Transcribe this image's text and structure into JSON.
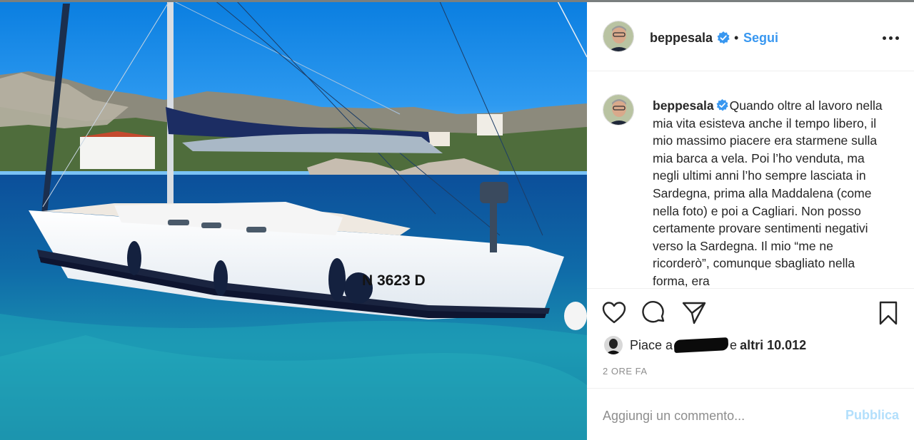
{
  "post": {
    "username": "beppesala",
    "verified": true,
    "separator": "•",
    "follow_label": "Segui",
    "more_icon": "more-horizontal-icon",
    "caption_text": "Quando oltre al lavoro nella mia vita esisteva anche il tempo libero, il mio massimo piacere era starmene sulla mia barca a vela. Poi l’ho venduta, ma negli ultimi anni l’ho sempre lasciata in Sardegna, prima alla Maddalena (come nella foto) e poi a Cagliari. Non posso certamente provare sentimenti negativi verso la Sardegna. Il mio “me ne ricorderò”, comunque sbagliato nella forma, era",
    "photo": {
      "boat_registration": "N 3623 D"
    }
  },
  "actions": {
    "icons": [
      "heart-icon",
      "comment-icon",
      "share-icon",
      "bookmark-icon"
    ],
    "likes_prefix": "Piace a",
    "likes_conjunction": "e",
    "likes_others": "altri 10.012",
    "timestamp": "2 ORE FA"
  },
  "comment": {
    "placeholder": "Aggiungi un commento...",
    "publish_label": "Pubblica"
  },
  "colors": {
    "link_blue": "#3897f0",
    "publish_disabled": "#b2dffc",
    "verified_blue": "#3897f0",
    "muted_text": "#8e8e8e"
  }
}
